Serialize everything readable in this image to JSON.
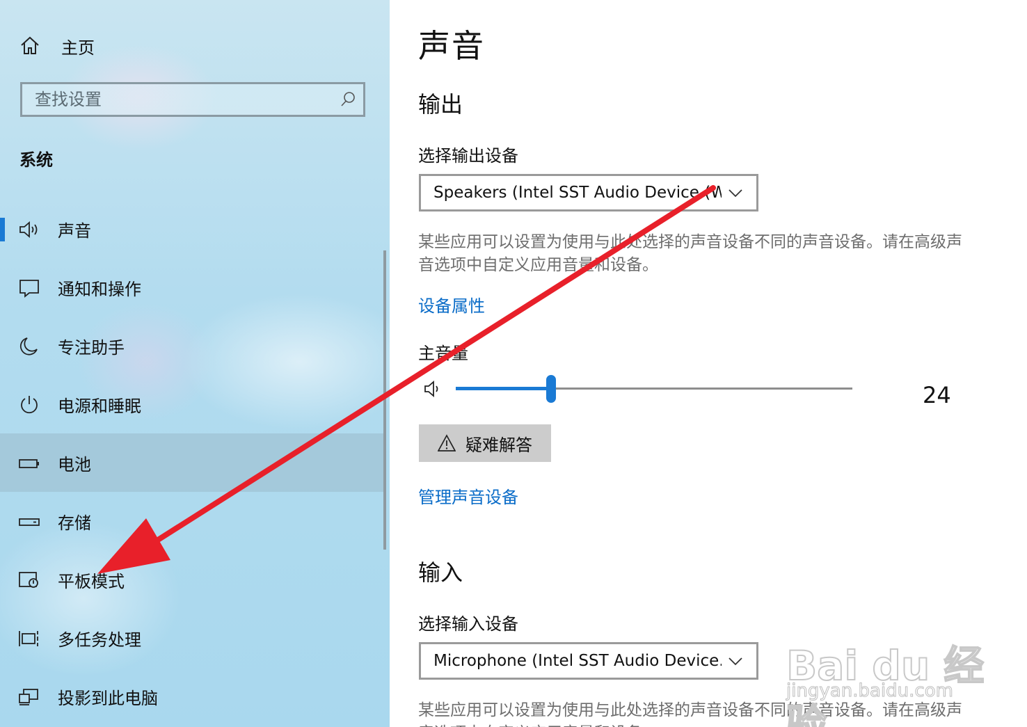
{
  "sidebar": {
    "home_label": "主页",
    "search_placeholder": "查找设置",
    "section_label": "系统",
    "items": [
      {
        "label": "声音",
        "icon": "speaker-icon"
      },
      {
        "label": "通知和操作",
        "icon": "message-icon"
      },
      {
        "label": "专注助手",
        "icon": "moon-icon"
      },
      {
        "label": "电源和睡眠",
        "icon": "power-icon"
      },
      {
        "label": "电池",
        "icon": "battery-icon"
      },
      {
        "label": "存储",
        "icon": "storage-icon"
      },
      {
        "label": "平板模式",
        "icon": "tablet-mode-icon"
      },
      {
        "label": "多任务处理",
        "icon": "multitask-icon"
      },
      {
        "label": "投影到此电脑",
        "icon": "project-icon"
      }
    ],
    "active_item": "声音",
    "hovered_item": "电池"
  },
  "main": {
    "title": "声音",
    "output": {
      "heading": "输出",
      "select_label": "选择输出设备",
      "selected_device": "Speakers (Intel SST Audio Device (W...",
      "description": "某些应用可以设置为使用与此处选择的声音设备不同的声音设备。请在高级声音选项中自定义应用音量和设备。",
      "device_properties_link": "设备属性",
      "master_volume_label": "主音量",
      "volume": 24,
      "troubleshoot_label": "疑难解答",
      "manage_devices_link": "管理声音设备"
    },
    "input": {
      "heading": "输入",
      "select_label": "选择输入设备",
      "selected_device": "Microphone (Intel SST Audio Device...",
      "description": "某些应用可以设置为使用与此处选择的声音设备不同的声音设备。请在高级声音选项中自定义应用音量和设备。"
    }
  },
  "colors": {
    "accent": "#1a7ad4",
    "link": "#0a6cc8",
    "annotation_arrow": "#e8202a"
  },
  "watermark": {
    "brand": "Bai du 经验",
    "url": "jingyan.baidu.com"
  }
}
